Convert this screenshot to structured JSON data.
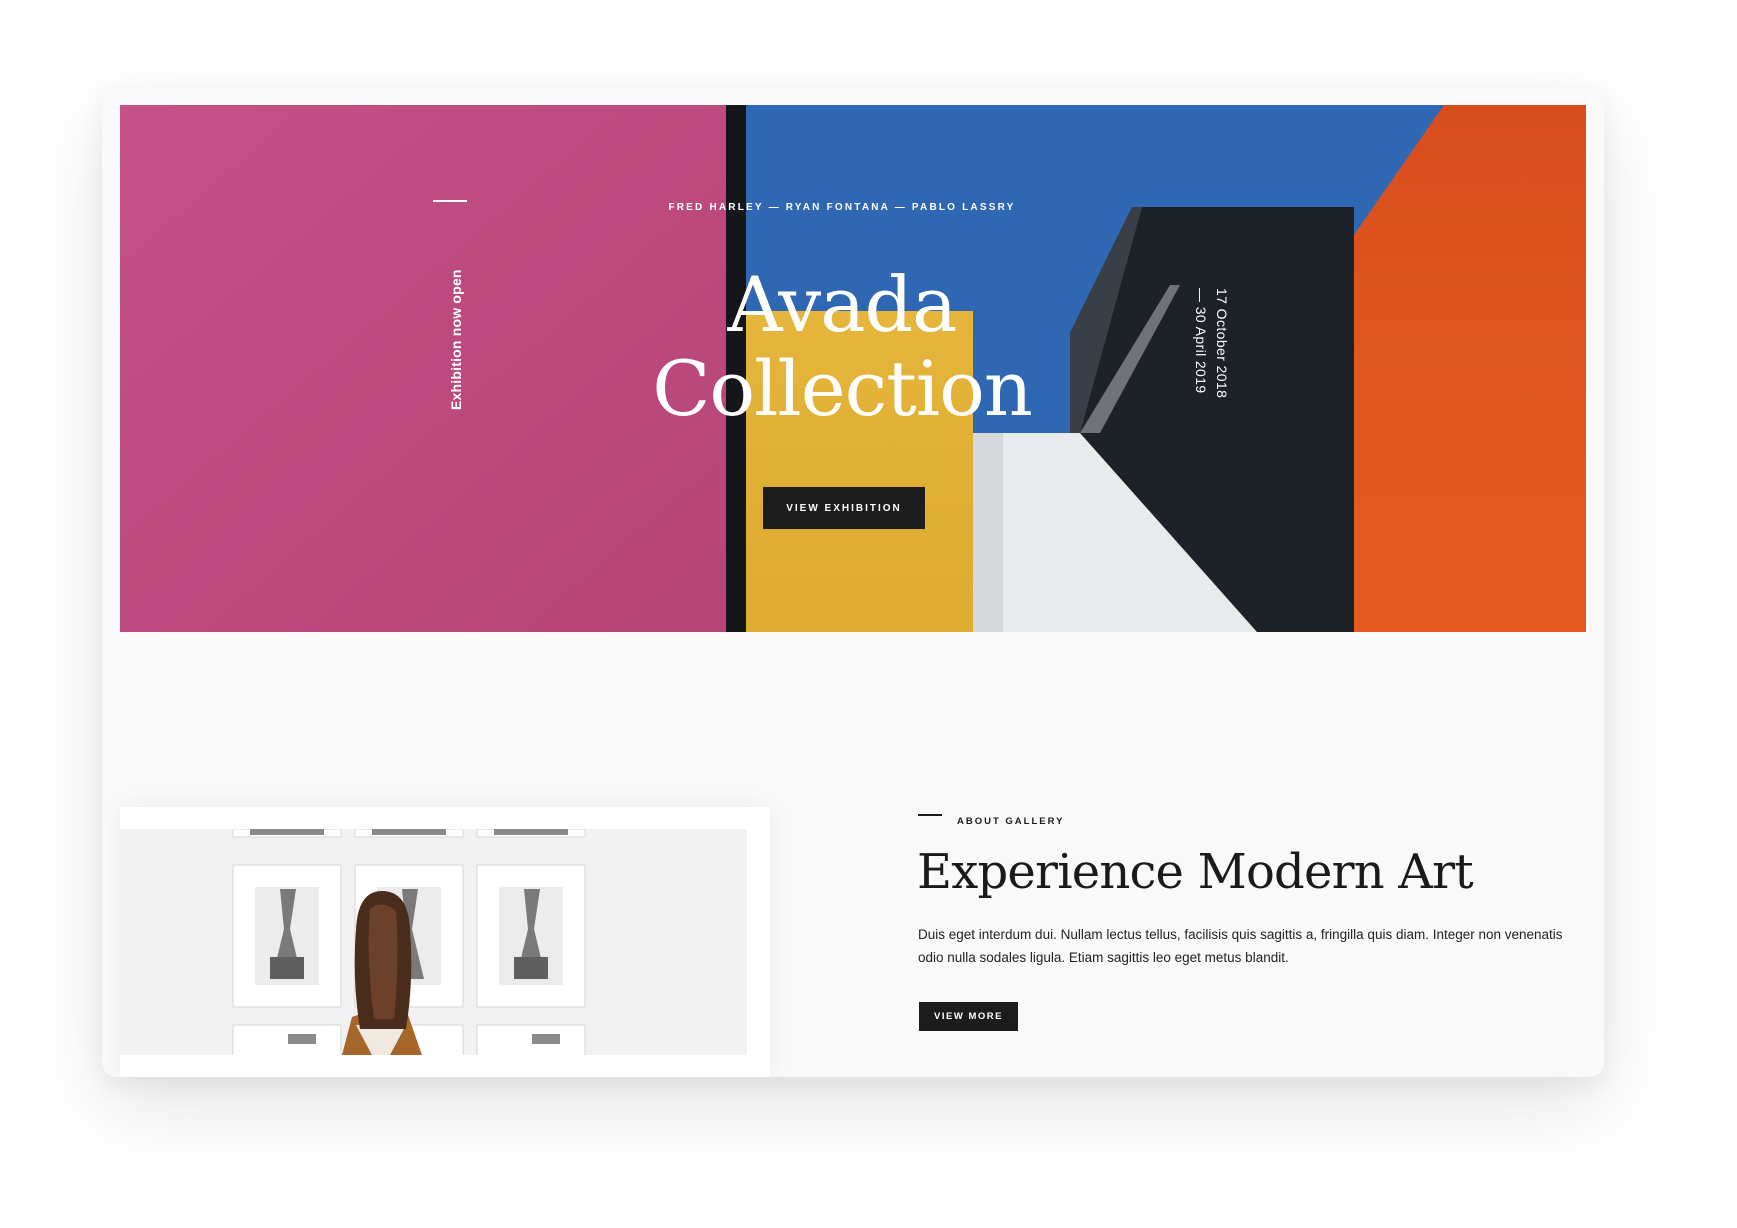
{
  "hero": {
    "artists": "FRED HARLEY — RYAN FONTANA — PABLO LASSRY",
    "title_line1": "Avada",
    "title_line2": "Collection",
    "status_vertical": "Exhibition now open",
    "dates_line1": "17 October 2018",
    "dates_line2": "— 30 April 2019",
    "button_label": "VIEW EXHIBITION"
  },
  "about": {
    "eyebrow": "ABOUT GALLERY",
    "heading": "Experience Modern Art",
    "body": "Duis eget interdum dui. Nullam lectus tellus, facilisis quis sagittis a, fringilla quis diam. Integer non venenatis odio nulla sodales ligula. Etiam sagittis leo eget metus blandit.",
    "button_label": "VIEW MORE"
  },
  "colors": {
    "magenta": "#c04a7e",
    "blue": "#2f67b2",
    "yellow": "#e2b137",
    "orange": "#e0561f",
    "dark": "#1d2128",
    "button": "#1c1c1c"
  }
}
